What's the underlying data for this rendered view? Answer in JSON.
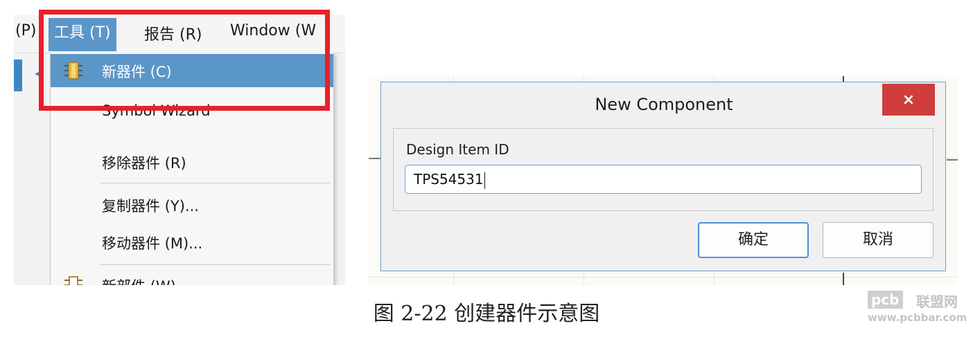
{
  "menubar": {
    "items": [
      {
        "label": "(P)"
      },
      {
        "label": "工具 (T)"
      },
      {
        "label": "报告 (R)"
      },
      {
        "label": "Window (W"
      }
    ]
  },
  "tools_menu": {
    "items": [
      {
        "label": "新器件 (C)",
        "icon": "component-icon-gold",
        "selected": true
      },
      {
        "label": "Symbol Wizard",
        "icon": null
      },
      {
        "label": "移除器件 (R)",
        "icon": null
      },
      {
        "label": "复制器件 (Y)...",
        "icon": null
      },
      {
        "label": "移动器件 (M)...",
        "icon": null
      },
      {
        "label": "新部件 (W)",
        "icon": "component-icon"
      }
    ]
  },
  "dialog": {
    "title": "New Component",
    "close_label": "×",
    "field_label": "Design Item ID",
    "field_value": "TPS54531",
    "ok_label": "确定",
    "cancel_label": "取消"
  },
  "caption": "图 2-22 创建器件示意图",
  "watermark": {
    "logo": "pcb",
    "name": "联盟网",
    "url": "www.pcbbar.com"
  },
  "colors": {
    "menu_selection": "#5b96c8",
    "highlight_border": "#e8202a",
    "close_button": "#cf3d3d",
    "input_border": "#6e9fd8"
  }
}
